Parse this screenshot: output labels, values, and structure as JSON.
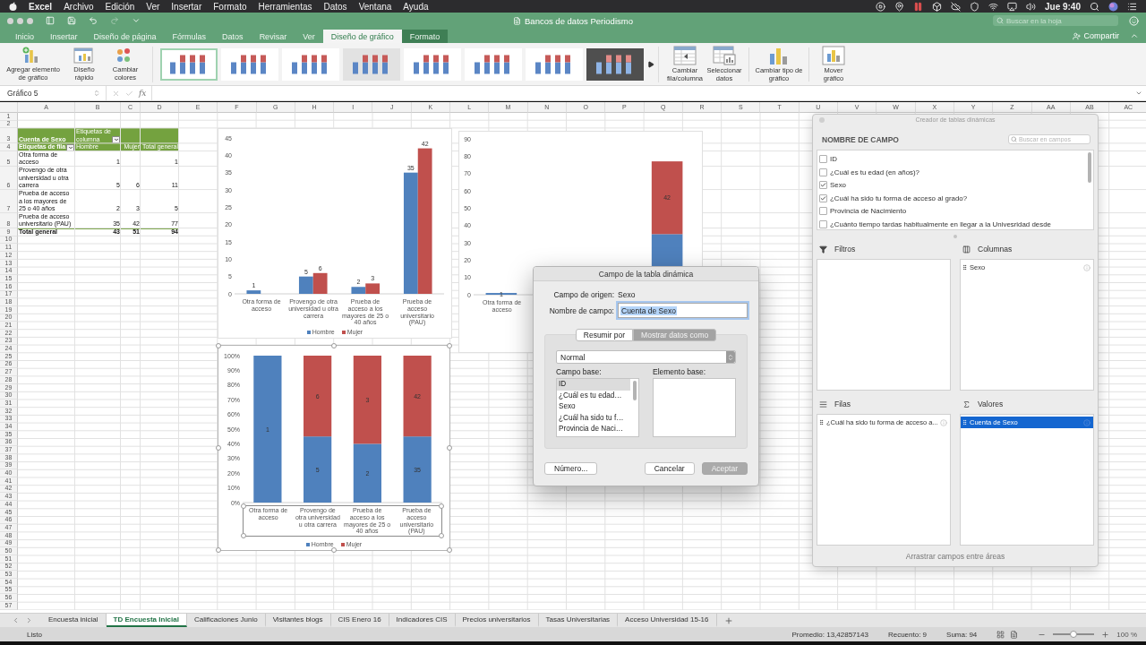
{
  "menubar": {
    "app": "Excel",
    "menus": [
      "Archivo",
      "Edición",
      "Ver",
      "Insertar",
      "Formato",
      "Herramientas",
      "Datos",
      "Ventana",
      "Ayuda"
    ],
    "clock": "Jue 9:40"
  },
  "window": {
    "title": "Bancos de datos Periodismo",
    "search": {
      "placeholder": "Buscar en la hoja"
    },
    "share": "Compartir"
  },
  "ribbon_tabs": [
    {
      "label": "Inicio",
      "selected": false,
      "kind": "normal"
    },
    {
      "label": "Insertar",
      "selected": false,
      "kind": "normal"
    },
    {
      "label": "Diseño de página",
      "selected": false,
      "kind": "normal"
    },
    {
      "label": "Fórmulas",
      "selected": false,
      "kind": "normal"
    },
    {
      "label": "Datos",
      "selected": false,
      "kind": "normal"
    },
    {
      "label": "Revisar",
      "selected": false,
      "kind": "normal"
    },
    {
      "label": "Ver",
      "selected": false,
      "kind": "normal"
    },
    {
      "label": "Diseño de gráfico",
      "selected": true,
      "kind": "contextual"
    },
    {
      "label": "Formato",
      "selected": false,
      "kind": "contextual"
    }
  ],
  "ribbon": {
    "left_buttons": [
      {
        "label": "Agregar elemento de gráfico",
        "kind": "add-element"
      },
      {
        "label": "Diseño rápido",
        "kind": "layout"
      },
      {
        "label": "Cambiar colores",
        "kind": "colors"
      }
    ],
    "chart_styles": [
      {
        "kind": "light",
        "selected": true
      },
      {
        "kind": "light",
        "selected": false
      },
      {
        "kind": "light",
        "selected": false
      },
      {
        "kind": "grey",
        "selected": false
      },
      {
        "kind": "light",
        "selected": false
      },
      {
        "kind": "light",
        "selected": false
      },
      {
        "kind": "light",
        "selected": false
      },
      {
        "kind": "dark",
        "selected": false
      }
    ],
    "right_buttons": [
      {
        "label": "Cambiar fila/columna",
        "kind": "switch"
      },
      {
        "label": "Seleccionar datos",
        "kind": "select-data"
      },
      {
        "label": "Cambiar tipo de gráfico",
        "kind": "chart-type"
      },
      {
        "label": "Mover gráfico",
        "kind": "move"
      }
    ]
  },
  "formula_bar": {
    "name_box": "Gráfico 5",
    "function_label": "fx"
  },
  "sheet": {
    "columns": [
      "A",
      "B",
      "C",
      "D",
      "E",
      "F",
      "G",
      "H",
      "I",
      "J",
      "K",
      "L",
      "M",
      "N",
      "O",
      "P",
      "Q",
      "R",
      "S",
      "T",
      "U",
      "V",
      "W",
      "X",
      "Y",
      "Z",
      "AA",
      "AB",
      "AC"
    ],
    "rows": [
      "1",
      "2",
      "3",
      "4",
      "5",
      "6",
      "7",
      "8",
      "9",
      "10",
      "11",
      "12",
      "13",
      "14",
      "15",
      "16",
      "17",
      "18",
      "19",
      "20",
      "21",
      "22",
      "23",
      "24",
      "25",
      "26",
      "27",
      "28",
      "29",
      "30",
      "31",
      "32",
      "33",
      "34",
      "35",
      "36",
      "37",
      "38",
      "39",
      "40",
      "41",
      "42",
      "43",
      "44",
      "45",
      "46",
      "47",
      "48",
      "49",
      "50",
      "51",
      "52",
      "53",
      "54",
      "55",
      "56",
      "57"
    ]
  },
  "pivot_table": {
    "value_field": "Cuenta de Sexo",
    "column_labels": "Etiquetas de columna",
    "row_labels": "Etiquetas de fila",
    "columns": [
      "Hombre",
      "Mujer",
      "Total general"
    ],
    "rows": [
      {
        "label": "Otra forma de acceso",
        "hombre": "1",
        "total": "1"
      },
      {
        "label": "Provengo de otra universidad u otra carrera",
        "hombre": "5",
        "mujer": "6",
        "total": "11"
      },
      {
        "label": "Prueba de acceso a los mayores de 25 o 40 años",
        "hombre": "2",
        "mujer": "3",
        "total": "5"
      },
      {
        "label": "Prueba de acceso universitario (PAU)",
        "hombre": "35",
        "mujer": "42",
        "total": "77"
      }
    ],
    "total": {
      "label": "Total general",
      "hombre": "43",
      "mujer": "51",
      "total": "94"
    }
  },
  "charts": [
    {
      "selected": false,
      "axis_selected": false,
      "chart_data": {
        "type": "bar",
        "stacked": false,
        "data_labels": true,
        "legend": "bottom",
        "categories": [
          "Otra forma de acceso",
          "Provengo de otra universidad u otra carrera",
          "Prueba de acceso a los mayores de 25 o 40 años",
          "Prueba de acceso universitario (PAU)"
        ],
        "series": [
          {
            "name": "Hombre",
            "color": "#4f81bd",
            "values": [
              1,
              5,
              2,
              35
            ]
          },
          {
            "name": "Mujer",
            "color": "#c0504d",
            "values": [
              null,
              6,
              3,
              42
            ]
          }
        ],
        "ylim": [
          0,
          45
        ],
        "yticks": [
          0,
          5,
          10,
          15,
          20,
          25,
          30,
          35,
          40,
          45
        ]
      }
    },
    {
      "selected": false,
      "axis_selected": false,
      "chart_data": {
        "type": "bar",
        "stacked": true,
        "categories": [
          "Otra forma de acceso",
          null,
          null,
          null
        ],
        "series": [
          {
            "color": "#4f81bd",
            "values": [
              1,
              null,
              null,
              35
            ]
          },
          {
            "color": "#c0504d",
            "values": [
              null,
              null,
              null,
              42
            ]
          }
        ],
        "value_labels": [
          [
            "1",
            null,
            null,
            null
          ],
          [
            null,
            null,
            null,
            "42"
          ]
        ],
        "ylim": [
          0,
          90
        ],
        "yticks": [
          0,
          10,
          20,
          30,
          40,
          50,
          60,
          70,
          80,
          90
        ]
      }
    },
    {
      "selected": true,
      "axis_selected": true,
      "chart_data": {
        "type": "bar",
        "stacked": true,
        "legend": "bottom",
        "categories": [
          "Otra forma de acceso",
          "Provengo de otra universidad u otra carrera",
          "Prueba de acceso a los mayores de 25 o 40 años",
          "Prueba de acceso universitario (PAU)"
        ],
        "series": [
          {
            "name": "Hombre",
            "color": "#4f81bd",
            "values": [
              1,
              0.45,
              0.4,
              0.45
            ]
          },
          {
            "name": "Mujer",
            "color": "#c0504d",
            "values": [
              null,
              0.55,
              0.6,
              0.55
            ]
          }
        ],
        "value_labels": [
          [
            "1",
            "5",
            "2",
            "35"
          ],
          [
            null,
            "6",
            "3",
            "42"
          ]
        ],
        "ylim": [
          0,
          1
        ],
        "yticks": [
          {
            "value": 0,
            "label": "0%"
          },
          {
            "value": 0.1,
            "label": "10%"
          },
          {
            "value": 0.2,
            "label": "20%"
          },
          {
            "value": 0.3,
            "label": "30%"
          },
          {
            "value": 0.4,
            "label": "40%"
          },
          {
            "value": 0.5,
            "label": "50%"
          },
          {
            "value": 0.6,
            "label": "60%"
          },
          {
            "value": 0.7,
            "label": "70%"
          },
          {
            "value": 0.8,
            "label": "80%"
          },
          {
            "value": 0.9,
            "label": "90%"
          },
          {
            "value": 1,
            "label": "100%"
          }
        ]
      }
    }
  ],
  "dialog": {
    "title": "Campo de la tabla dinámica",
    "source": {
      "label": "Campo de origen:",
      "value": "Sexo"
    },
    "name": {
      "label": "Nombre de campo:",
      "value": "Cuenta de Sexo",
      "text_selected": true
    },
    "tabs": [
      {
        "label": "Resumir por",
        "selected": false
      },
      {
        "label": "Mostrar datos como",
        "selected": true
      }
    ],
    "show_as": "Normal",
    "base_field": {
      "label": "Campo base:",
      "items": [
        {
          "label": "ID",
          "selected": true
        },
        {
          "label": "¿Cuál es tu edad…",
          "selected": false
        },
        {
          "label": "Sexo",
          "selected": false
        },
        {
          "label": "¿Cuál ha sido tu f…",
          "selected": false
        },
        {
          "label": "Provincia de Naci…",
          "selected": false
        }
      ]
    },
    "base_item": {
      "label": "Elemento base:"
    },
    "buttons": [
      {
        "label": "Número...",
        "kind": "normal",
        "disabled": false
      },
      {
        "label": "Cancelar",
        "kind": "normal",
        "disabled": false
      },
      {
        "label": "Aceptar",
        "kind": "default",
        "disabled": true
      }
    ]
  },
  "pivot_builder": {
    "title": "Creador de tablas dinámicas",
    "heading": "NOMBRE DE CAMPO",
    "search": {
      "placeholder": "Buscar en campos"
    },
    "fields": [
      {
        "label": "ID",
        "checked": false
      },
      {
        "label": "¿Cuál es tu edad (en años)?",
        "checked": false
      },
      {
        "label": "Sexo",
        "checked": true
      },
      {
        "label": "¿Cuál ha sido tu forma de acceso al grado?",
        "checked": true
      },
      {
        "label": "Provincia de Nacimiento",
        "checked": false
      },
      {
        "label": "¿Cuánto tiempo tardas habitualmente en llegar a la Univesridad desde",
        "checked": false
      }
    ],
    "areas": [
      {
        "kind": "filters",
        "label": "Filtros"
      },
      {
        "kind": "columns",
        "label": "Columnas",
        "items": [
          {
            "label": "Sexo",
            "selected": false
          }
        ]
      },
      {
        "kind": "rows",
        "label": "Filas",
        "items": [
          {
            "label": "¿Cuál ha sido tu forma de acceso a...",
            "selected": false
          }
        ]
      },
      {
        "kind": "values",
        "label": "Valores",
        "items": [
          {
            "label": "Cuenta de Sexo",
            "selected": true
          }
        ]
      }
    ],
    "footer": "Arrastrar campos entre áreas"
  },
  "sheet_tabs": [
    {
      "label": "Encuesta inicial",
      "selected": false
    },
    {
      "label": "TD Encuesta Inicial",
      "selected": true
    },
    {
      "label": "Calificaciones Junio",
      "selected": false
    },
    {
      "label": "Visitantes blogs",
      "selected": false
    },
    {
      "label": "CIS Enero 16",
      "selected": false
    },
    {
      "label": "Indicadores CIS",
      "selected": false
    },
    {
      "label": "Precios universitarios",
      "selected": false
    },
    {
      "label": "Tasas Universitarias",
      "selected": false
    },
    {
      "label": "Acceso Universidad 15-16",
      "selected": false
    }
  ],
  "status_bar": {
    "status": "Listo",
    "average": "Promedio: 13,42857143",
    "count": "Recuento: 9",
    "sum": "Suma: 94",
    "zoom": {
      "level": 0.5,
      "reading": "100 %"
    }
  }
}
